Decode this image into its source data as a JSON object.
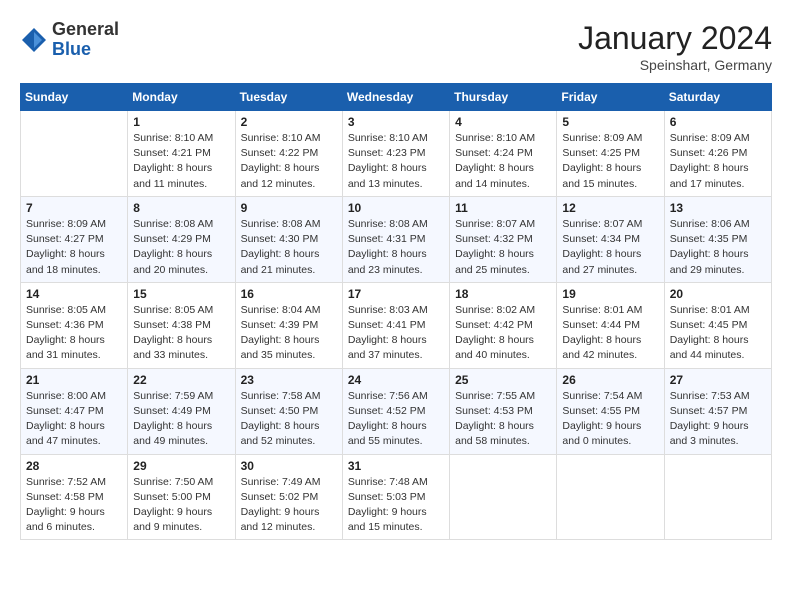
{
  "header": {
    "logo_general": "General",
    "logo_blue": "Blue",
    "month_year": "January 2024",
    "location": "Speinshart, Germany"
  },
  "weekdays": [
    "Sunday",
    "Monday",
    "Tuesday",
    "Wednesday",
    "Thursday",
    "Friday",
    "Saturday"
  ],
  "weeks": [
    [
      {
        "day": "",
        "info": ""
      },
      {
        "day": "1",
        "info": "Sunrise: 8:10 AM\nSunset: 4:21 PM\nDaylight: 8 hours\nand 11 minutes."
      },
      {
        "day": "2",
        "info": "Sunrise: 8:10 AM\nSunset: 4:22 PM\nDaylight: 8 hours\nand 12 minutes."
      },
      {
        "day": "3",
        "info": "Sunrise: 8:10 AM\nSunset: 4:23 PM\nDaylight: 8 hours\nand 13 minutes."
      },
      {
        "day": "4",
        "info": "Sunrise: 8:10 AM\nSunset: 4:24 PM\nDaylight: 8 hours\nand 14 minutes."
      },
      {
        "day": "5",
        "info": "Sunrise: 8:09 AM\nSunset: 4:25 PM\nDaylight: 8 hours\nand 15 minutes."
      },
      {
        "day": "6",
        "info": "Sunrise: 8:09 AM\nSunset: 4:26 PM\nDaylight: 8 hours\nand 17 minutes."
      }
    ],
    [
      {
        "day": "7",
        "info": ""
      },
      {
        "day": "8",
        "info": "Sunrise: 8:08 AM\nSunset: 4:29 PM\nDaylight: 8 hours\nand 20 minutes."
      },
      {
        "day": "9",
        "info": "Sunrise: 8:08 AM\nSunset: 4:30 PM\nDaylight: 8 hours\nand 21 minutes."
      },
      {
        "day": "10",
        "info": "Sunrise: 8:08 AM\nSunset: 4:31 PM\nDaylight: 8 hours\nand 23 minutes."
      },
      {
        "day": "11",
        "info": "Sunrise: 8:07 AM\nSunset: 4:32 PM\nDaylight: 8 hours\nand 25 minutes."
      },
      {
        "day": "12",
        "info": "Sunrise: 8:07 AM\nSunset: 4:34 PM\nDaylight: 8 hours\nand 27 minutes."
      },
      {
        "day": "13",
        "info": "Sunrise: 8:06 AM\nSunset: 4:35 PM\nDaylight: 8 hours\nand 29 minutes."
      }
    ],
    [
      {
        "day": "14",
        "info": ""
      },
      {
        "day": "15",
        "info": "Sunrise: 8:05 AM\nSunset: 4:38 PM\nDaylight: 8 hours\nand 33 minutes."
      },
      {
        "day": "16",
        "info": "Sunrise: 8:04 AM\nSunset: 4:39 PM\nDaylight: 8 hours\nand 35 minutes."
      },
      {
        "day": "17",
        "info": "Sunrise: 8:03 AM\nSunset: 4:41 PM\nDaylight: 8 hours\nand 37 minutes."
      },
      {
        "day": "18",
        "info": "Sunrise: 8:02 AM\nSunset: 4:42 PM\nDaylight: 8 hours\nand 40 minutes."
      },
      {
        "day": "19",
        "info": "Sunrise: 8:01 AM\nSunset: 4:44 PM\nDaylight: 8 hours\nand 42 minutes."
      },
      {
        "day": "20",
        "info": "Sunrise: 8:01 AM\nSunset: 4:45 PM\nDaylight: 8 hours\nand 44 minutes."
      }
    ],
    [
      {
        "day": "21",
        "info": ""
      },
      {
        "day": "22",
        "info": "Sunrise: 7:59 AM\nSunset: 4:49 PM\nDaylight: 8 hours\nand 49 minutes."
      },
      {
        "day": "23",
        "info": "Sunrise: 7:58 AM\nSunset: 4:50 PM\nDaylight: 8 hours\nand 52 minutes."
      },
      {
        "day": "24",
        "info": "Sunrise: 7:56 AM\nSunset: 4:52 PM\nDaylight: 8 hours\nand 55 minutes."
      },
      {
        "day": "25",
        "info": "Sunrise: 7:55 AM\nSunset: 4:53 PM\nDaylight: 8 hours\nand 58 minutes."
      },
      {
        "day": "26",
        "info": "Sunrise: 7:54 AM\nSunset: 4:55 PM\nDaylight: 9 hours\nand 0 minutes."
      },
      {
        "day": "27",
        "info": "Sunrise: 7:53 AM\nSunset: 4:57 PM\nDaylight: 9 hours\nand 3 minutes."
      }
    ],
    [
      {
        "day": "28",
        "info": ""
      },
      {
        "day": "29",
        "info": "Sunrise: 7:50 AM\nSunset: 5:00 PM\nDaylight: 9 hours\nand 9 minutes."
      },
      {
        "day": "30",
        "info": "Sunrise: 7:49 AM\nSunset: 5:02 PM\nDaylight: 9 hours\nand 12 minutes."
      },
      {
        "day": "31",
        "info": "Sunrise: 7:48 AM\nSunset: 5:03 PM\nDaylight: 9 hours\nand 15 minutes."
      },
      {
        "day": "",
        "info": ""
      },
      {
        "day": "",
        "info": ""
      },
      {
        "day": "",
        "info": ""
      }
    ]
  ],
  "week1_sunday_info": "Sunrise: 8:09 AM\nSunset: 4:27 PM\nDaylight: 8 hours\nand 18 minutes.",
  "week3_sunday_info": "Sunrise: 8:05 AM\nSunset: 4:36 PM\nDaylight: 8 hours\nand 31 minutes.",
  "week4_sunday_info": "Sunrise: 8:00 AM\nSunset: 4:47 PM\nDaylight: 8 hours\nand 47 minutes.",
  "week5_sunday_info": "Sunrise: 7:52 AM\nSunset: 4:58 PM\nDaylight: 9 hours\nand 6 minutes."
}
